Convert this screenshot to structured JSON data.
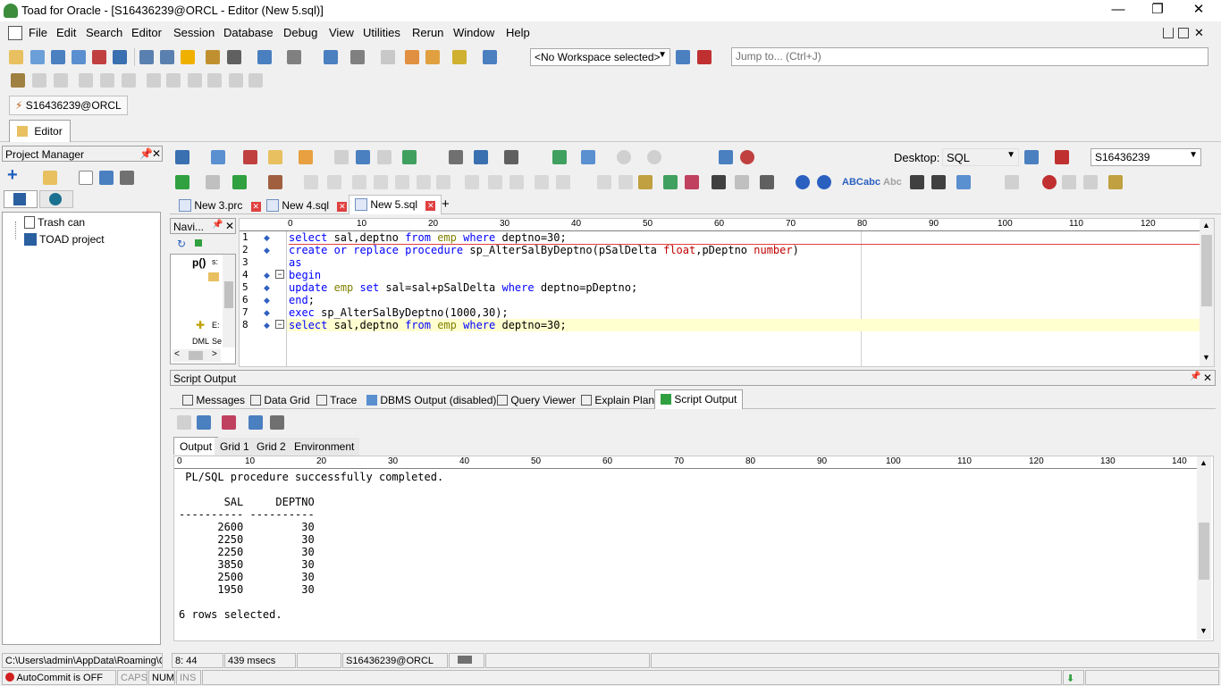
{
  "window": {
    "title": "Toad for Oracle - [S16436239@ORCL - Editor (New 5.sql)]",
    "minimize": "—",
    "restore": "❐",
    "close": "✕"
  },
  "menu": [
    "File",
    "Edit",
    "Search",
    "Editor",
    "Session",
    "Database",
    "Debug",
    "View",
    "Utilities",
    "Rerun",
    "Window",
    "Help"
  ],
  "toolbar": {
    "workspace": "<No Workspace selected>",
    "jump_placeholder": "Jump to... (Ctrl+J)"
  },
  "connection_tab": "S16436239@ORCL",
  "editor_tab": "Editor",
  "project_manager": {
    "title": "Project Manager",
    "items": [
      "Trash can",
      "TOAD project"
    ]
  },
  "editor_toolbar": {
    "desktop_label": "Desktop:",
    "desktop_value": "SQL",
    "schema_value": "S16436239",
    "abc1": "ABC",
    "abc2": "abc",
    "abc3": "Abc"
  },
  "file_tabs": [
    {
      "label": "New 3.prc",
      "icon": "PL SQL"
    },
    {
      "label": "New 4.sql",
      "icon": "SQL"
    },
    {
      "label": "New 5.sql",
      "icon": "SQL"
    }
  ],
  "add_tab": "+",
  "navigator": {
    "title": "Navi...",
    "nodes": [
      "p()",
      "s:",
      "E:",
      "Se",
      "DML"
    ]
  },
  "ruler": [
    "0",
    "10",
    "20",
    "30",
    "40",
    "50",
    "60",
    "70",
    "80",
    "90",
    "100",
    "110",
    "120"
  ],
  "code": {
    "line_numbers": [
      "1",
      "2",
      "3",
      "4",
      "5",
      "6",
      "7",
      "8"
    ]
  },
  "script_output": {
    "title": "Script Output",
    "tabs": [
      "Messages",
      "Data Grid",
      "Trace",
      "DBMS Output (disabled)",
      "Query Viewer",
      "Explain Plan",
      "Script Output"
    ],
    "subtabs": [
      "Output",
      "Grid 1",
      "Grid 2",
      "Environment"
    ],
    "ruler": [
      "0",
      "10",
      "20",
      "30",
      "40",
      "50",
      "60",
      "70",
      "80",
      "90",
      "100",
      "110",
      "120",
      "130",
      "140"
    ],
    "lines": [
      " PL/SQL procedure successfully completed.",
      "",
      "       SAL     DEPTNO",
      "---------- ----------",
      "      2600         30",
      "      2250         30",
      "      2250         30",
      "      3850         30",
      "      2500         30",
      "      1950         30",
      "",
      "6 rows selected."
    ]
  },
  "status": {
    "path": "C:\\Users\\admin\\AppData\\Roaming\\Q",
    "position": "8: 44",
    "elapsed": "439 msecs",
    "connection": "S16436239@ORCL",
    "autocommit": "AutoCommit is OFF",
    "caps": "CAPS",
    "num": "NUM",
    "ins": "INS"
  }
}
